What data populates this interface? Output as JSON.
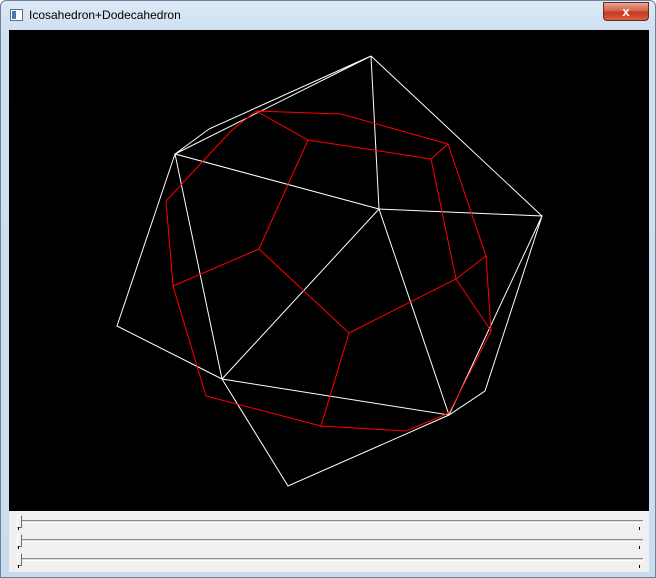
{
  "window": {
    "title": "Icosahedron+Dodecahedron",
    "close_glyph": "x",
    "app_icon": "window-app-icon"
  },
  "scene": {
    "background_color": "#000000",
    "icosahedron_color": "#ffffff",
    "dodecahedron_color": "#ff0000"
  },
  "sliders": [
    {
      "name": "slider-1",
      "value": 0
    },
    {
      "name": "slider-2",
      "value": 0
    },
    {
      "name": "slider-3",
      "value": 0
    }
  ]
}
